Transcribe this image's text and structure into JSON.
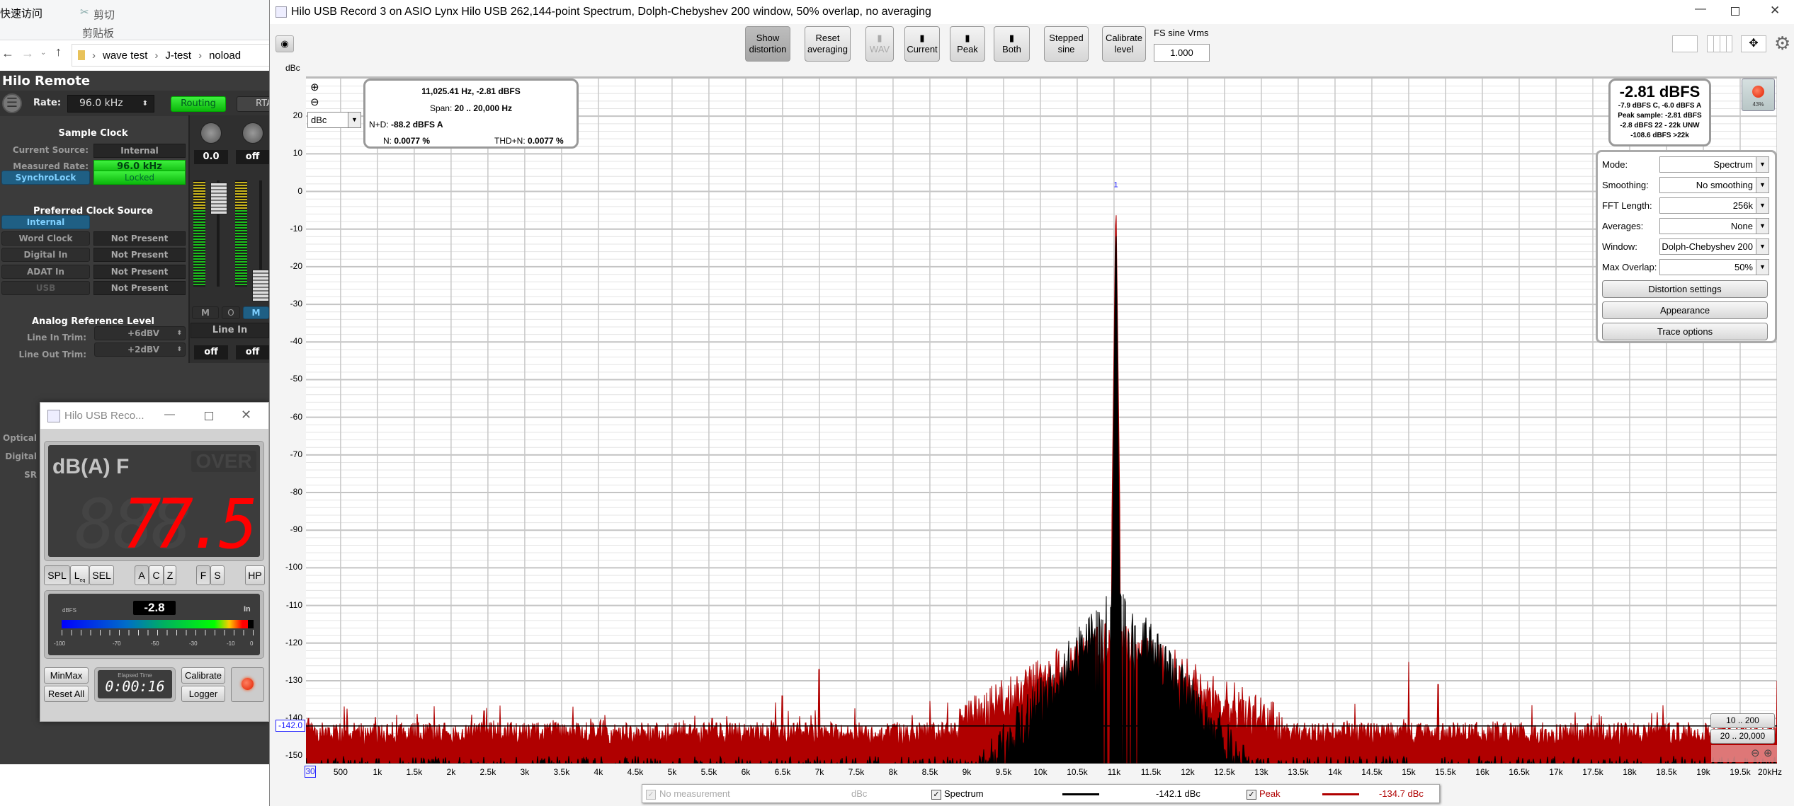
{
  "explorer": {
    "quick_access": "快速访问",
    "cut": "剪切",
    "clipboard_group": "剪贴板",
    "breadcrumb": [
      "wave test",
      "J-test",
      "noload"
    ]
  },
  "remote": {
    "title": "Hilo Remote",
    "rate_label": "Rate:",
    "rate_value": "96.0 kHz",
    "routing": "Routing",
    "rta": "RTA",
    "sample_clock": {
      "heading": "Sample Clock",
      "current_source_label": "Current Source:",
      "current_source": "Internal",
      "measured_rate_label": "Measured Rate:",
      "measured_rate": "96.0 kHz",
      "synchrolock": "SynchroLock",
      "lock_status": "Locked"
    },
    "preferred": {
      "heading": "Preferred Clock Source",
      "items": [
        {
          "label": "Internal",
          "status": ""
        },
        {
          "label": "Word Clock",
          "status": "Not Present"
        },
        {
          "label": "Digital In",
          "status": "Not Present"
        },
        {
          "label": "ADAT In",
          "status": "Not Present"
        },
        {
          "label": "USB",
          "status": "Not Present"
        }
      ]
    },
    "analog": {
      "heading": "Analog Reference Level",
      "line_in_label": "Line In Trim:",
      "line_in": "+6dBV",
      "line_out_label": "Line Out Trim:",
      "line_out": "+2dBV"
    },
    "hidden_labels": [
      "Optical",
      "Digital",
      "SR"
    ],
    "mixer": {
      "pan_values": [
        "0.0",
        "off"
      ],
      "buttons": [
        "M",
        "O",
        "M"
      ],
      "input_name": "Line In",
      "bottom_values": [
        "off",
        "off"
      ]
    }
  },
  "meter": {
    "title": "Hilo USB Reco...",
    "mode": "dB(A) F",
    "over": "OVER",
    "reading": "77.5",
    "buttons": {
      "spl": "SPL",
      "leq": "L",
      "leq_sub": "eq",
      "sel": "SEL",
      "a": "A",
      "c": "C",
      "z": "Z",
      "f": "F",
      "s": "S",
      "hp": "HP"
    },
    "level_unit": "dBFS",
    "level_value": "-2.8",
    "level_channel": "In",
    "level_fraction": 0.97,
    "scale_labels": [
      "-100",
      "-70",
      "-50",
      "-30",
      "-10",
      "0"
    ],
    "minmax": "MinMax",
    "reset_all": "Reset All",
    "elapsed_label": "Elapsed Time",
    "elapsed": "0:00:16",
    "calibrate": "Calibrate",
    "logger": "Logger"
  },
  "main": {
    "title": "Hilo USB Record 3 on ASIO Lynx Hilo USB 262,144-point Spectrum, Dolph-Chebyshev 200 window, 50% overlap, no averaging",
    "toolbar": {
      "show_distortion": [
        "Show",
        "distortion"
      ],
      "reset_averaging": [
        "Reset",
        "averaging"
      ],
      "wav": "WAV",
      "current": "Current",
      "peak": "Peak",
      "both": "Both",
      "stepped_sine": [
        "Stepped",
        "sine"
      ],
      "calibrate_level": [
        "Calibrate",
        "level"
      ],
      "fs_label": "FS sine Vrms",
      "fs_value": "1.000"
    },
    "unit_label": "dBc",
    "unit_select": "dBc",
    "info": {
      "cursor": "11,025.41 Hz, -2.81 dBFS",
      "span_label": "Span:",
      "span": "20 .. 20,000 Hz",
      "nd_label": "N+D:",
      "nd": "-88.2 dBFS A",
      "n_label": "N:",
      "n": "0.0077 %",
      "thdn_label": "THD+N:",
      "thdn": "0.0077 %"
    },
    "level": {
      "main": "-2.81 dBFS",
      "lines": [
        "-7.9 dBFS C, -6.0 dBFS A",
        "Peak sample: -2.81 dBFS",
        "-2.8 dBFS 22 - 22k UNW",
        "-108.6 dBFS >22k"
      ]
    },
    "record_pct": "43%",
    "settings": {
      "rows": [
        {
          "label": "Mode:",
          "value": "Spectrum"
        },
        {
          "label": "Smoothing:",
          "value": "No  smoothing"
        },
        {
          "label": "FFT Length:",
          "value": "256k"
        },
        {
          "label": "Averages:",
          "value": "None"
        },
        {
          "label": "Window:",
          "value": "Dolph-Chebyshev 200"
        },
        {
          "label": "Max Overlap:",
          "value": "50%"
        }
      ],
      "distortion_settings": "Distortion settings",
      "appearance": "Appearance",
      "trace_options": "Trace options"
    },
    "range_buttons": [
      "10 .. 200",
      "20 .. 20,000"
    ],
    "marker_value": "-142.0",
    "x_start": "30",
    "peak_marker_label": "1",
    "legend": {
      "no_measurement": "No measurement",
      "no_measurement_unit": "dBc",
      "spectrum": "Spectrum",
      "spectrum_value": "-142.1 dBc",
      "peak": "Peak",
      "peak_value": "-134.7 dBc"
    }
  },
  "chart_data": {
    "type": "area",
    "xlabel": "",
    "ylabel": "dBc",
    "xlim": [
      30,
      20000
    ],
    "ylim": [
      -152,
      30
    ],
    "grid": true,
    "x_scale": "linear",
    "yticks": [
      20,
      10,
      0,
      -10,
      -20,
      -30,
      -40,
      -50,
      -60,
      -70,
      -80,
      -90,
      -100,
      -110,
      -120,
      -130,
      -140,
      -150
    ],
    "xticks": [
      {
        "v": 500,
        "l": "500"
      },
      {
        "v": 1000,
        "l": "1k"
      },
      {
        "v": 1500,
        "l": "1.5k"
      },
      {
        "v": 2000,
        "l": "2k"
      },
      {
        "v": 2500,
        "l": "2.5k"
      },
      {
        "v": 3000,
        "l": "3k"
      },
      {
        "v": 3500,
        "l": "3.5k"
      },
      {
        "v": 4000,
        "l": "4k"
      },
      {
        "v": 4500,
        "l": "4.5k"
      },
      {
        "v": 5000,
        "l": "5k"
      },
      {
        "v": 5500,
        "l": "5.5k"
      },
      {
        "v": 6000,
        "l": "6k"
      },
      {
        "v": 6500,
        "l": "6.5k"
      },
      {
        "v": 7000,
        "l": "7k"
      },
      {
        "v": 7500,
        "l": "7.5k"
      },
      {
        "v": 8000,
        "l": "8k"
      },
      {
        "v": 8500,
        "l": "8.5k"
      },
      {
        "v": 9000,
        "l": "9k"
      },
      {
        "v": 9500,
        "l": "9.5k"
      },
      {
        "v": 10000,
        "l": "10k"
      },
      {
        "v": 10500,
        "l": "10.5k"
      },
      {
        "v": 11000,
        "l": "11k"
      },
      {
        "v": 11500,
        "l": "11.5k"
      },
      {
        "v": 12000,
        "l": "12k"
      },
      {
        "v": 12500,
        "l": "12.5k"
      },
      {
        "v": 13000,
        "l": "13k"
      },
      {
        "v": 13500,
        "l": "13.5k"
      },
      {
        "v": 14000,
        "l": "14k"
      },
      {
        "v": 14500,
        "l": "14.5k"
      },
      {
        "v": 15000,
        "l": "15k"
      },
      {
        "v": 15500,
        "l": "15.5k"
      },
      {
        "v": 16000,
        "l": "16k"
      },
      {
        "v": 16500,
        "l": "16.5k"
      },
      {
        "v": 17000,
        "l": "17k"
      },
      {
        "v": 17500,
        "l": "17.5k"
      },
      {
        "v": 18000,
        "l": "18k"
      },
      {
        "v": 18500,
        "l": "18.5k"
      },
      {
        "v": 19000,
        "l": "19k"
      },
      {
        "v": 19500,
        "l": "19.5k"
      },
      {
        "v": 20000,
        "l": "20kHz"
      }
    ],
    "fundamental": {
      "freq_hz": 11025.41,
      "level_dbc": 0,
      "level_dbfs": -2.81
    },
    "marker_line_dbc": -142.0,
    "series": [
      {
        "name": "Spectrum",
        "color": "#000000",
        "noise_floor_dbc": -152,
        "skirt_peak_dbc": -100
      },
      {
        "name": "Peak",
        "color": "#b00000",
        "noise_floor_dbc": -145,
        "skirt_peak_dbc": -113,
        "spurs": [
          {
            "freq_hz": 60,
            "dbc": -140
          },
          {
            "freq_hz": 1540,
            "dbc": -140
          },
          {
            "freq_hz": 2450,
            "dbc": -138
          },
          {
            "freq_hz": 3050,
            "dbc": -142
          },
          {
            "freq_hz": 5540,
            "dbc": -140
          },
          {
            "freq_hz": 6500,
            "dbc": -134
          },
          {
            "freq_hz": 7000,
            "dbc": -127
          },
          {
            "freq_hz": 15000,
            "dbc": -125
          },
          {
            "freq_hz": 15400,
            "dbc": -131
          },
          {
            "freq_hz": 20000,
            "dbc": -130
          }
        ]
      }
    ]
  }
}
